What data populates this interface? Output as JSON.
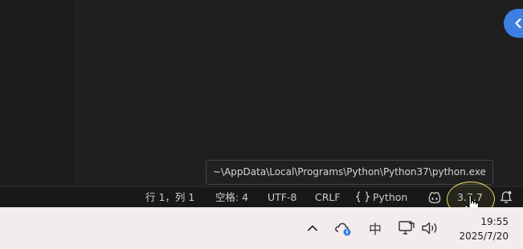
{
  "tooltip": {
    "interpreter_path": "~\\AppData\\Local\\Programs\\Python\\Python37\\python.exe"
  },
  "statusbar": {
    "cursor_position": "行 1，列 1",
    "indentation": "空格: 4",
    "encoding": "UTF-8",
    "line_endings": "CRLF",
    "language": "Python",
    "language_icon": "curly-braces-icon",
    "copilot_icon": "copilot-icon",
    "interpreter_version": "3.7.7",
    "notifications_icon": "bell-icon"
  },
  "taskbar": {
    "show_hidden_icons": "chevron-up-icon",
    "onedrive_icon": "cloud-icon",
    "ime_mode": "中",
    "network_icon": "network-icon",
    "volume_icon": "speaker-icon",
    "time": "19:55",
    "date": "2025/7/20"
  },
  "colors": {
    "accent": "#3d7fe0",
    "highlight_ring": "#e6dd5a",
    "taskbar": "#f3eced"
  }
}
